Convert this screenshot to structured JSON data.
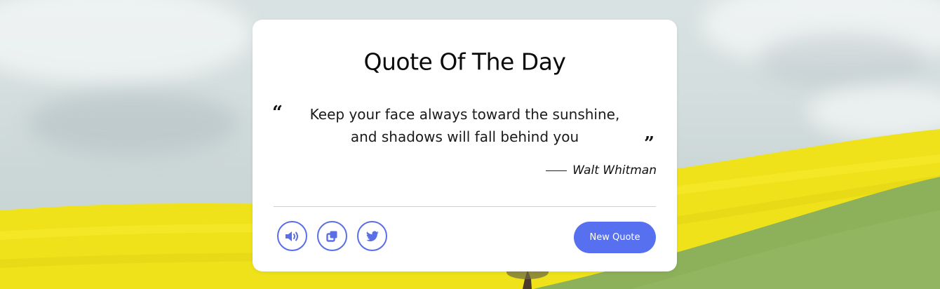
{
  "card": {
    "title": "Quote Of The Day",
    "quote_open_mark": "“",
    "quote_close_mark": "”",
    "quote_line_1": "Keep your face always toward the sunshine,",
    "quote_line_2": "and shadows will fall behind you",
    "author": "Walt Whitman"
  },
  "actions": {
    "speech_icon": "volume-icon",
    "copy_icon": "copy-icon",
    "twitter_icon": "twitter-icon",
    "new_quote_label": "New Quote"
  },
  "colors": {
    "accent": "#5670f0",
    "icon_border": "#5a6fe6",
    "field_yellow": "#f0e21a",
    "grass": "#8fb25a"
  }
}
